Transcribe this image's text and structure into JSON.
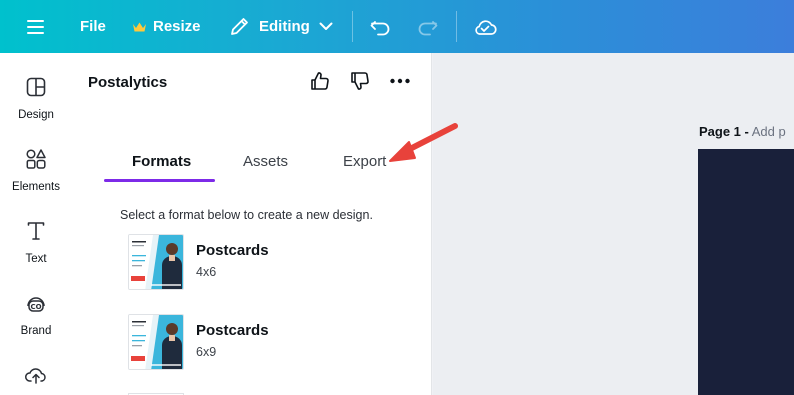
{
  "topbar": {
    "file_label": "File",
    "resize_label": "Resize",
    "editing_label": "Editing"
  },
  "rail": {
    "items": [
      {
        "label": "Design",
        "icon": "design-icon"
      },
      {
        "label": "Elements",
        "icon": "elements-icon"
      },
      {
        "label": "Text",
        "icon": "text-icon"
      },
      {
        "label": "Brand",
        "icon": "brand-icon"
      },
      {
        "label": "",
        "icon": "uploads-icon"
      }
    ]
  },
  "panel": {
    "app_title": "Postalytics",
    "tabs": [
      {
        "label": "Formats",
        "active": true
      },
      {
        "label": "Assets",
        "active": false
      },
      {
        "label": "Export",
        "active": false
      }
    ],
    "instruction": "Select a format below to create a new design.",
    "formats": [
      {
        "name": "Postcards",
        "size": "4x6"
      },
      {
        "name": "Postcards",
        "size": "6x9"
      }
    ]
  },
  "canvas": {
    "page_label": "Page 1 -",
    "add_page_title": "Add p"
  },
  "colors": {
    "accent": "#7d2ae8",
    "arrow": "#e8423b",
    "topbar_start": "#00c1cd",
    "topbar_end": "#3c7edb"
  }
}
